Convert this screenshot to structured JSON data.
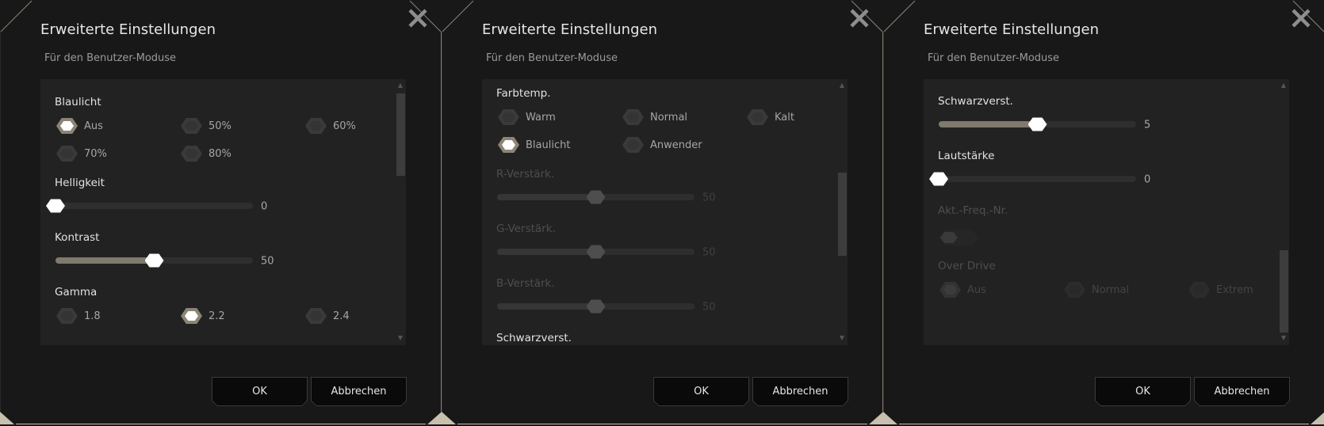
{
  "colors": {
    "accent": "#8c8576",
    "frame": "#c8c0ae",
    "panel": "#181818",
    "content": "#222222"
  },
  "dialogs": [
    {
      "title": "Erweiterte Einstellungen",
      "subtitle": "Für den Benutzer-Moduse",
      "close_icon": "close-x-icon",
      "ok_label": "OK",
      "cancel_label": "Abbrechen",
      "scroll_position": 0.0,
      "sections": [
        {
          "type": "radio",
          "label": "Blaulicht",
          "options": [
            "Aus",
            "50%",
            "60%",
            "70%",
            "80%"
          ],
          "selected": "Aus",
          "disabled": false
        },
        {
          "type": "slider",
          "label": "Helligkeit",
          "value": 0,
          "max": 100,
          "display": "0",
          "disabled": false
        },
        {
          "type": "slider",
          "label": "Kontrast",
          "value": 50,
          "max": 100,
          "display": "50",
          "disabled": false
        },
        {
          "type": "radio",
          "label": "Gamma",
          "options": [
            "1.8",
            "2.2",
            "2.4"
          ],
          "selected": "2.2",
          "disabled": false
        }
      ]
    },
    {
      "title": "Erweiterte Einstellungen",
      "subtitle": "Für den Benutzer-Moduse",
      "close_icon": "close-x-icon",
      "ok_label": "OK",
      "cancel_label": "Abbrechen",
      "scroll_position": 0.5,
      "sections": [
        {
          "type": "radio",
          "label": "Farbtemp.",
          "options": [
            "Warm",
            "Normal",
            "Kalt",
            "Blaulicht",
            "Anwender"
          ],
          "selected": "Blaulicht",
          "disabled": false
        },
        {
          "type": "slider",
          "label": "R-Verstärk.",
          "value": 50,
          "max": 100,
          "display": "50",
          "disabled": true
        },
        {
          "type": "slider",
          "label": "G-Verstärk.",
          "value": 50,
          "max": 100,
          "display": "50",
          "disabled": true
        },
        {
          "type": "slider",
          "label": "B-Verstärk.",
          "value": 50,
          "max": 100,
          "display": "50",
          "disabled": true
        },
        {
          "type": "heading",
          "label": "Schwarzverst.",
          "disabled": false
        }
      ]
    },
    {
      "title": "Erweiterte Einstellungen",
      "subtitle": "Für den Benutzer-Moduse",
      "close_icon": "close-x-icon",
      "ok_label": "OK",
      "cancel_label": "Abbrechen",
      "scroll_position": 1.0,
      "sections": [
        {
          "type": "slider",
          "label": "Schwarzverst.",
          "value": 5,
          "max": 10,
          "display": "5",
          "disabled": false
        },
        {
          "type": "slider",
          "label": "Lautstärke",
          "value": 0,
          "max": 100,
          "display": "0",
          "disabled": false
        },
        {
          "type": "toggle",
          "label": "Akt.-Freq.-Nr.",
          "on": false,
          "disabled": true
        },
        {
          "type": "radio",
          "label": "Over Drive",
          "options": [
            "Aus",
            "Normal",
            "Extrem"
          ],
          "selected": "Aus",
          "disabled": true
        }
      ]
    }
  ]
}
